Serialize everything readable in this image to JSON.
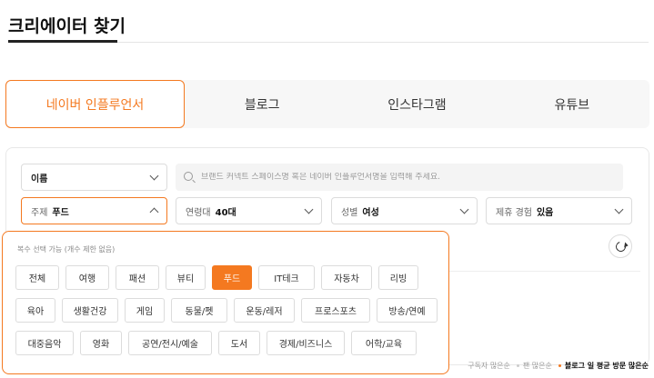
{
  "page": {
    "title": "크리에이터 찾기"
  },
  "tabs": [
    {
      "label": "네이버 인플루언서",
      "active": true
    },
    {
      "label": "블로그"
    },
    {
      "label": "인스타그램"
    },
    {
      "label": "유튜브"
    }
  ],
  "filters": {
    "name_select": {
      "value": "이름"
    },
    "search": {
      "placeholder": "브랜드 커넥트 스페이스명 혹은 네이버 인플루언서명을 입력해 주세요."
    },
    "topic": {
      "label": "주제",
      "value": "푸드"
    },
    "age": {
      "label": "연령대",
      "value": "40대"
    },
    "gender": {
      "label": "성별",
      "value": "여성"
    },
    "experience": {
      "label": "제휴 경험",
      "value": "있음"
    }
  },
  "topic_dropdown": {
    "hint": "복수 선택 가능 (개수 제한 없음)",
    "rows": [
      [
        "전체",
        "여행",
        "패션",
        "뷰티",
        "푸드",
        "IT테크",
        "자동차",
        "리빙"
      ],
      [
        "육아",
        "생활건강",
        "게임",
        "동물/펫",
        "운동/레저",
        "프로스포츠",
        "방송/연예"
      ],
      [
        "대중음악",
        "영화",
        "공연/전시/예술",
        "도서",
        "경제/비즈니스",
        "어학/교육"
      ]
    ],
    "selected": "푸드"
  },
  "sort": {
    "options": [
      "구독자 많은순",
      "팬 많은순",
      "블로그 일 평균 방문 많은순"
    ],
    "active": "블로그 일 평균 방문 많은순"
  },
  "icons": {
    "search": "search-icon",
    "refresh": "refresh-icon",
    "chevron": "chevron-down-icon"
  },
  "colors": {
    "accent": "#f47920"
  }
}
